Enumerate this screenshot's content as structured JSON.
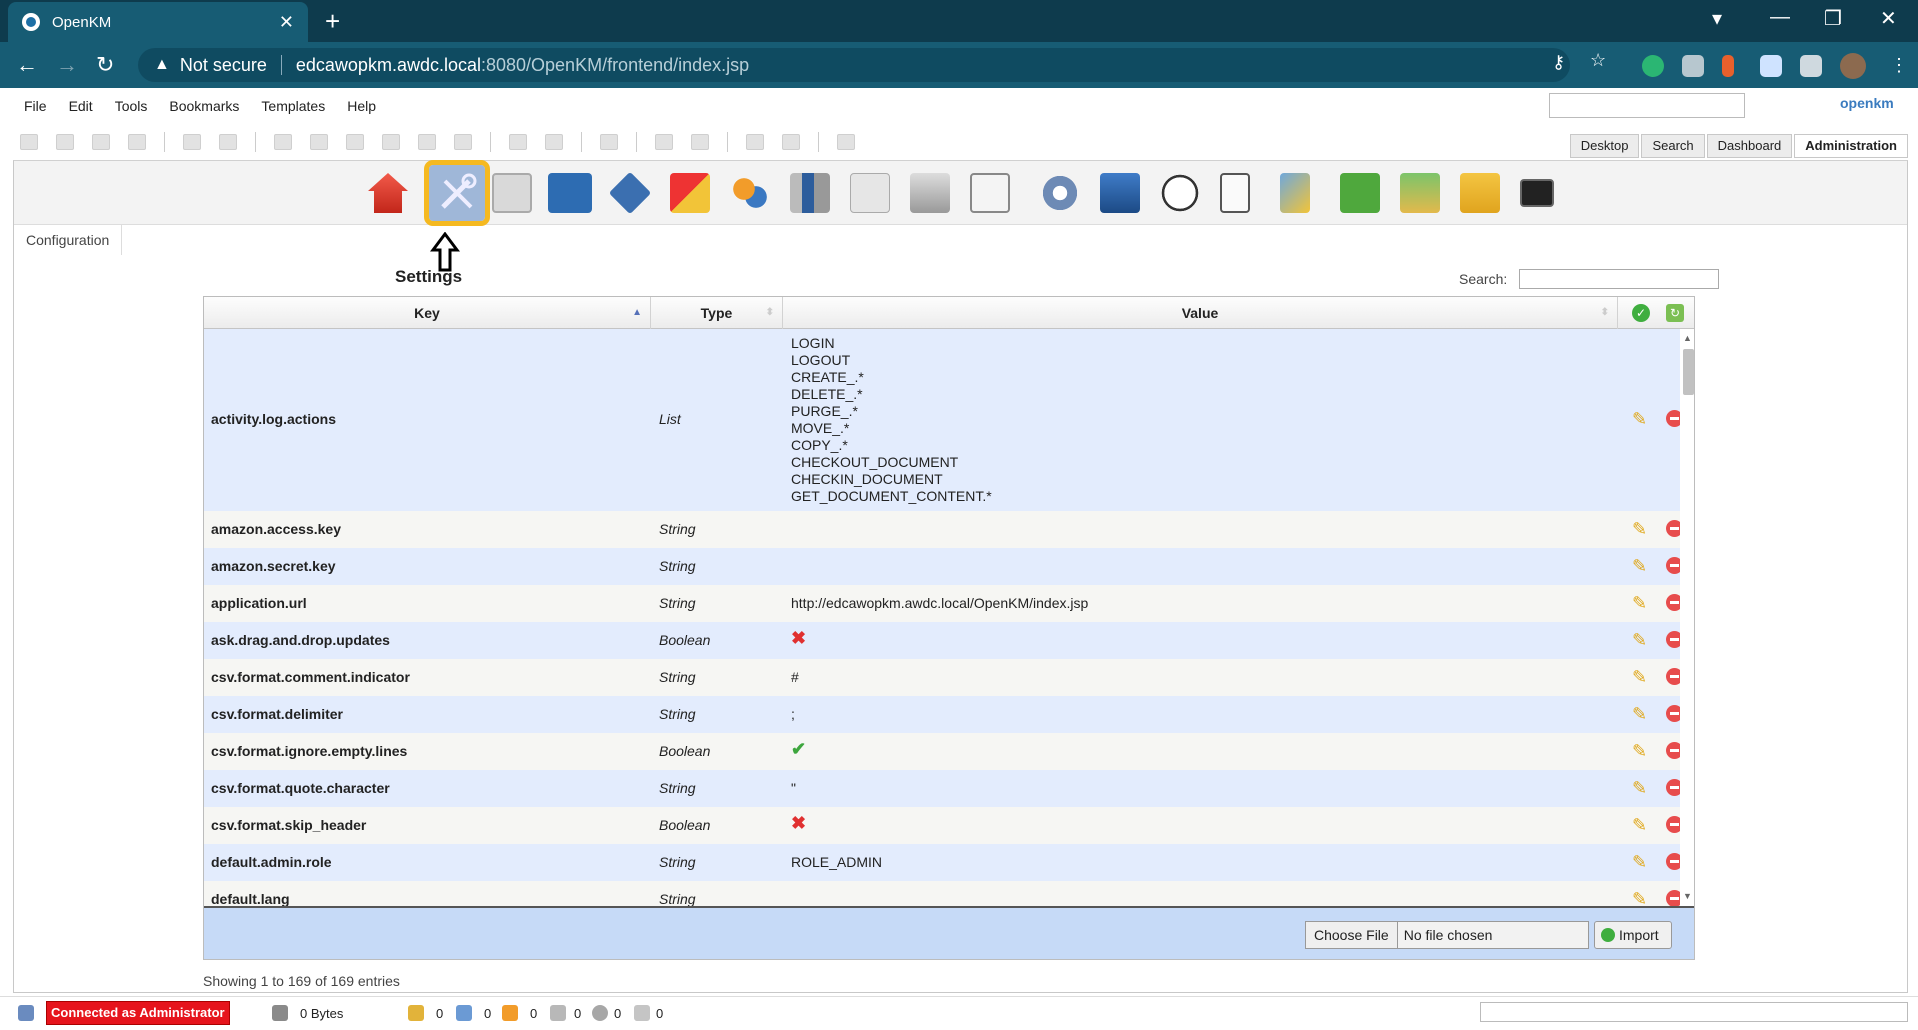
{
  "browser": {
    "tab_title": "OpenKM",
    "not_secure": "Not secure",
    "url_host": "edcawopkm.awdc.local",
    "url_path": ":8080/OpenKM/frontend/index.jsp"
  },
  "menu": [
    "File",
    "Edit",
    "Tools",
    "Bookmarks",
    "Templates",
    "Help"
  ],
  "logo": "openkm",
  "workspace_tabs": [
    "Desktop",
    "Search",
    "Dashboard",
    "Administration"
  ],
  "admin": {
    "breadcrumb": "Configuration",
    "settings_label": "Settings",
    "search_label": "Search:",
    "tools": [
      "home-tool-icon",
      "settings-tool-icon",
      "check-tool-icon",
      "monitor-tool-icon",
      "workflow-tool-icon",
      "utilities-tool-icon",
      "users-tool-icon",
      "profiles-tool-icon",
      "reports-tool-icon",
      "scripting-tool-icon",
      "calendar-tool-icon",
      "gear-tool-icon",
      "automation-tool-icon",
      "clock-tool-icon",
      "lists-tool-icon",
      "filter-tool-icon",
      "stamp-tool-icon",
      "import-tool-icon",
      "export-tool-icon",
      "terminal-tool-icon"
    ]
  },
  "grid": {
    "headers": {
      "key": "Key",
      "type": "Type",
      "value": "Value"
    },
    "rows": [
      {
        "key": "activity.log.actions",
        "type": "List",
        "value_lines": [
          "LOGIN",
          "LOGOUT",
          "CREATE_.*",
          "DELETE_.*",
          "PURGE_.*",
          "MOVE_.*",
          "COPY_.*",
          "CHECKOUT_DOCUMENT",
          "CHECKIN_DOCUMENT",
          "GET_DOCUMENT_CONTENT.*"
        ]
      },
      {
        "key": "amazon.access.key",
        "type": "String",
        "value": ""
      },
      {
        "key": "amazon.secret.key",
        "type": "String",
        "value": ""
      },
      {
        "key": "application.url",
        "type": "String",
        "value": "http://edcawopkm.awdc.local/OpenKM/index.jsp"
      },
      {
        "key": "ask.drag.and.drop.updates",
        "type": "Boolean",
        "value": "false"
      },
      {
        "key": "csv.format.comment.indicator",
        "type": "String",
        "value": "#"
      },
      {
        "key": "csv.format.delimiter",
        "type": "String",
        "value": ";"
      },
      {
        "key": "csv.format.ignore.empty.lines",
        "type": "Boolean",
        "value": "true"
      },
      {
        "key": "csv.format.quote.character",
        "type": "String",
        "value": "\""
      },
      {
        "key": "csv.format.skip_header",
        "type": "Boolean",
        "value": "false"
      },
      {
        "key": "default.admin.role",
        "type": "String",
        "value": "ROLE_ADMIN"
      },
      {
        "key": "default.lang",
        "type": "String",
        "value": ""
      }
    ],
    "choose_file": "Choose File",
    "no_file": "No file chosen",
    "import": "Import",
    "showing": "Showing 1 to 169 of 169 entries"
  },
  "status": {
    "connected": "Connected as Administrator",
    "bytes": "0 Bytes",
    "counts": [
      "0",
      "0",
      "0",
      "0",
      "0",
      "0"
    ]
  }
}
